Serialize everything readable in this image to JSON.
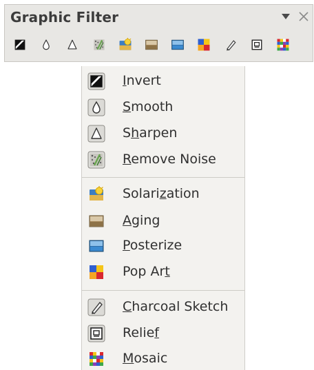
{
  "toolbar": {
    "title": "Graphic Filter",
    "dropdown_glyph": "▼",
    "close_glyph": "✕",
    "buttons": [
      {
        "name": "invert",
        "icon": "invert-icon"
      },
      {
        "name": "smooth",
        "icon": "smooth-icon"
      },
      {
        "name": "sharpen",
        "icon": "sharpen-icon"
      },
      {
        "name": "remove-noise",
        "icon": "remove-noise-icon"
      },
      {
        "name": "solarization",
        "icon": "solarization-icon"
      },
      {
        "name": "aging",
        "icon": "aging-icon"
      },
      {
        "name": "posterize",
        "icon": "posterize-icon"
      },
      {
        "name": "pop-art",
        "icon": "pop-art-icon"
      },
      {
        "name": "charcoal-sketch",
        "icon": "charcoal-sketch-icon"
      },
      {
        "name": "relief",
        "icon": "relief-icon"
      },
      {
        "name": "mosaic",
        "icon": "mosaic-icon"
      }
    ]
  },
  "menu": {
    "items": [
      {
        "label": "Invert",
        "mnemonic": "I",
        "icon": "invert-icon"
      },
      {
        "label": "Smooth",
        "mnemonic": "S",
        "icon": "smooth-icon"
      },
      {
        "label": "Sharpen",
        "mnemonic": "h",
        "icon": "sharpen-icon"
      },
      {
        "label": "Remove Noise",
        "mnemonic": "R",
        "icon": "remove-noise-icon"
      },
      {
        "label": "Solarization",
        "mnemonic": "z",
        "icon": "solarization-icon"
      },
      {
        "label": "Aging",
        "mnemonic": "A",
        "icon": "aging-icon"
      },
      {
        "label": "Posterize",
        "mnemonic": "P",
        "icon": "posterize-icon"
      },
      {
        "label": "Pop Art",
        "mnemonic": "t",
        "icon": "pop-art-icon"
      },
      {
        "label": "Charcoal Sketch",
        "mnemonic": "C",
        "icon": "charcoal-sketch-icon"
      },
      {
        "label": "Relief",
        "mnemonic": "f",
        "icon": "relief-icon"
      },
      {
        "label": "Mosaic",
        "mnemonic": "M",
        "icon": "mosaic-icon"
      }
    ]
  },
  "colors": {
    "panel_bg": "#e8e7e4",
    "menu_bg": "#f3f2ef",
    "text": "#303030"
  }
}
